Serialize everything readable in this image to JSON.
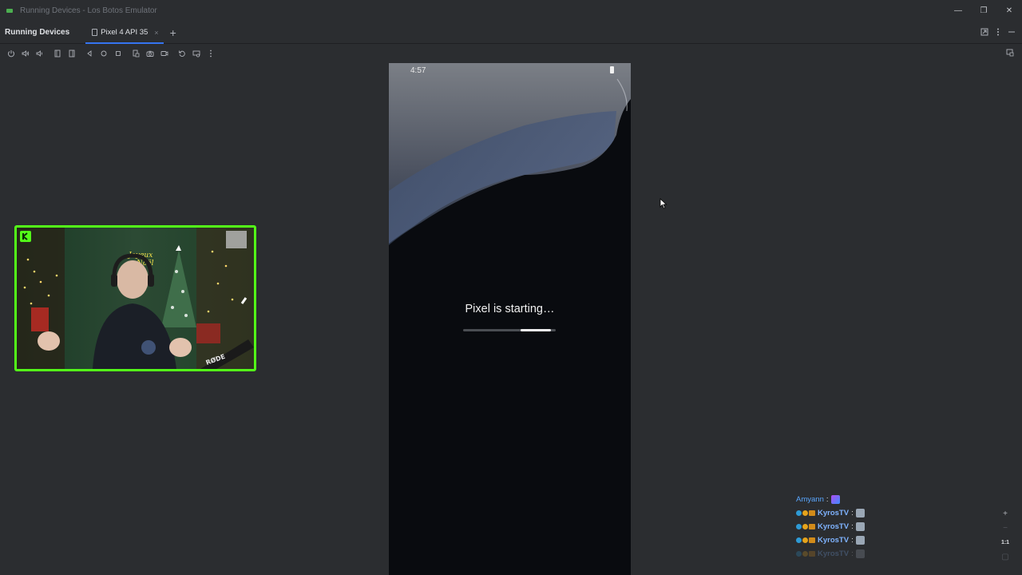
{
  "window": {
    "title": "Running Devices - Los Botos Emulator",
    "controls": [
      "—",
      "❐",
      "✕"
    ]
  },
  "tool_window": {
    "title": "Running Devices",
    "tabs": [
      {
        "label": "Pixel 4 API 35",
        "active": true,
        "close": "×"
      }
    ],
    "add_tab": "+"
  },
  "toolbar": {
    "buttons": [
      "power-icon",
      "volume-up-icon",
      "volume-down-icon",
      "rotate-left-icon",
      "rotate-right-icon",
      "back-icon",
      "home-icon",
      "overview-icon",
      "fold-icon",
      "screenshot-icon",
      "screenrecord-icon",
      "reset-icon",
      "extended-controls-icon",
      "more-icon"
    ]
  },
  "device": {
    "status_time": "4:57",
    "boot_message": "Pixel is starting…",
    "progress_segment": {
      "start": 0.62,
      "end": 0.95
    }
  },
  "chat": {
    "messages": [
      {
        "user": "Amyann",
        "separator": ":"
      },
      {
        "user": "KyrosTV",
        "separator": ":"
      },
      {
        "user": "KyrosTV",
        "separator": ":"
      },
      {
        "user": "KyrosTV",
        "separator": ":"
      },
      {
        "user": "KyrosTV",
        "separator": ":"
      }
    ]
  },
  "zoom": {
    "plus": "+",
    "minus": "−",
    "actual_size": "1:1",
    "fit": "▢"
  },
  "colors": {
    "accent": "#3574f0",
    "webcam_border": "#53fc18",
    "background": "#2b2d30"
  }
}
